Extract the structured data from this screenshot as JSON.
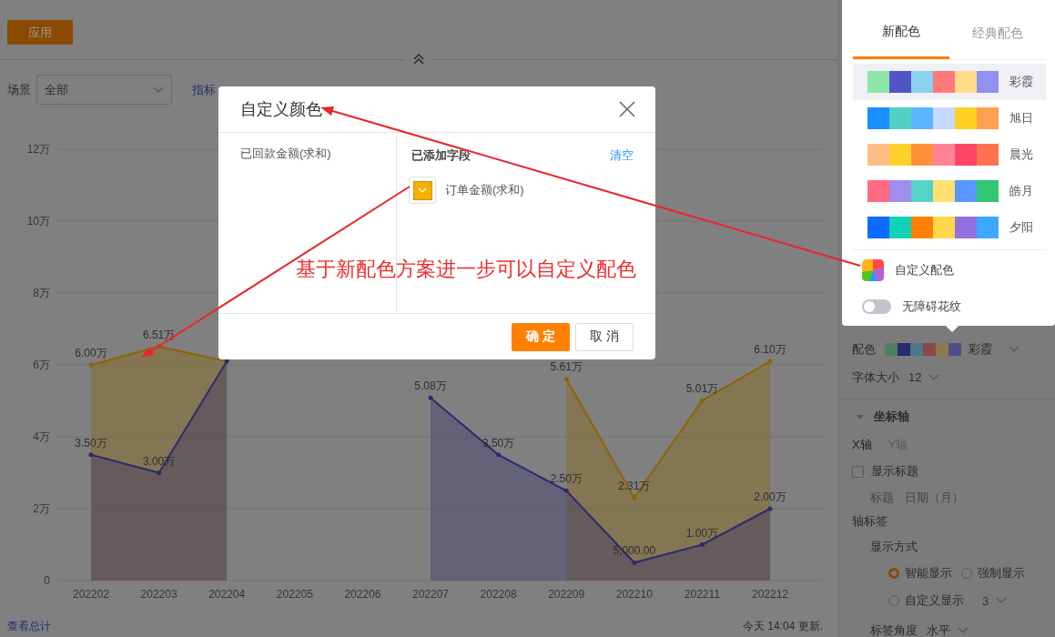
{
  "toolbar": {
    "apply_button": "应用"
  },
  "filters": {
    "scene_label": "场景",
    "scene_select": {
      "value": "全部"
    },
    "metric_link": "指标"
  },
  "chart": {
    "chart_data": {
      "type": "area",
      "categories": [
        "202202",
        "202203",
        "202204",
        "202205",
        "202206",
        "202207",
        "202208",
        "202209",
        "202210",
        "202211",
        "202212"
      ],
      "ylim": [
        0,
        12
      ],
      "grid": true,
      "yticks": [
        {
          "value": 0,
          "label": "0"
        },
        {
          "value": 2,
          "label": "2万"
        },
        {
          "value": 4,
          "label": "4万"
        },
        {
          "value": 6,
          "label": "6万"
        },
        {
          "value": 8,
          "label": "8万"
        },
        {
          "value": 10,
          "label": "10万"
        },
        {
          "value": 12,
          "label": "12万"
        }
      ],
      "series": [
        {
          "type": "area",
          "color": "#8c6400",
          "values": [
            6.0,
            6.51,
            6.1,
            null,
            null,
            null,
            null,
            5.61,
            2.31,
            5.01,
            6.1
          ]
        },
        {
          "type": "area",
          "color": "#2d2b6e",
          "values": [
            3.5,
            3.0,
            6.1,
            null,
            null,
            5.08,
            3.5,
            2.5,
            0.5,
            1.0,
            2.0
          ]
        }
      ],
      "value_labels": [
        [
          "6.00万",
          "6.51万",
          null,
          null,
          null,
          null,
          null,
          "5.61万",
          "2.31万",
          "5.01万",
          "6.10万"
        ],
        [
          "3.50万",
          "3.00万",
          null,
          null,
          null,
          "5.08万",
          "3.50万",
          "2.50万",
          "5,000.00",
          "1.00万",
          "2.00万"
        ]
      ]
    }
  },
  "footer": {
    "total_link": "查看总计",
    "updated": "今天 14:04 更新."
  },
  "settings_panel": {
    "palette": {
      "label": "配色",
      "colors": [
        {
          "color": "#4e8060"
        },
        {
          "color": "#2a2a70"
        },
        {
          "color": "#4a7888"
        },
        {
          "color": "#8a4848"
        },
        {
          "color": "#8a7850"
        },
        {
          "color": "#505088"
        }
      ],
      "value": "彩霞"
    },
    "font_size": {
      "label": "字体大小",
      "value": "12"
    },
    "axis_section": {
      "title": "坐标轴",
      "expanded": true,
      "axis_tabs": [
        {
          "label": "X轴",
          "selected": true
        },
        {
          "label": "Y轴",
          "selected": false
        }
      ],
      "show_title": {
        "label": "显示标题",
        "checked": false
      },
      "title_field": {
        "label": "标题",
        "value": "日期（月）"
      },
      "axis_labels": {
        "title": "轴标签",
        "display_mode_label": "显示方式",
        "modes": [
          {
            "label": "智能显示",
            "selected": true
          },
          {
            "label": "强制显示",
            "selected": false
          },
          {
            "label": "自定义显示",
            "selected": false,
            "count": "3"
          }
        ],
        "angle": {
          "label": "标签角度",
          "value": "水平"
        }
      }
    }
  },
  "color_popover": {
    "tabs": [
      {
        "label": "新配色",
        "selected": true
      },
      {
        "label": "经典配色",
        "selected": false
      }
    ],
    "palettes": [
      {
        "name": "彩霞",
        "selected": true,
        "colors": [
          {
            "color": "#8ee6a8"
          },
          {
            "color": "#5254c4"
          },
          {
            "color": "#8bd2f0"
          },
          {
            "color": "#ff7b7b"
          },
          {
            "color": "#ffdc8c"
          },
          {
            "color": "#9191ee"
          }
        ]
      },
      {
        "name": "旭日",
        "selected": false,
        "colors": [
          {
            "color": "#1890ff"
          },
          {
            "color": "#53d0c6"
          },
          {
            "color": "#5bb5ff"
          },
          {
            "color": "#c6d9ff"
          },
          {
            "color": "#ffd022"
          },
          {
            "color": "#ffa04e"
          }
        ]
      },
      {
        "name": "晨光",
        "selected": false,
        "colors": [
          {
            "color": "#ffbd86"
          },
          {
            "color": "#ffd12d"
          },
          {
            "color": "#ff913c"
          },
          {
            "color": "#ff8394"
          },
          {
            "color": "#ff4566"
          },
          {
            "color": "#ff724f"
          }
        ]
      },
      {
        "name": "皓月",
        "selected": false,
        "colors": [
          {
            "color": "#ff6a83"
          },
          {
            "color": "#9f8eee"
          },
          {
            "color": "#54d3c6"
          },
          {
            "color": "#ffe070"
          },
          {
            "color": "#5897ff"
          },
          {
            "color": "#2fc674"
          }
        ]
      },
      {
        "name": "夕阳",
        "selected": false,
        "colors": [
          {
            "color": "#0e6bff"
          },
          {
            "color": "#11d3b7"
          },
          {
            "color": "#ff8000"
          },
          {
            "color": "#ffd74a"
          },
          {
            "color": "#9370e0"
          },
          {
            "color": "#3aa8ff"
          }
        ]
      }
    ],
    "custom_option": "自定义配色",
    "pattern_toggle": {
      "label": "无障碍花纹",
      "on": false
    }
  },
  "dialog": {
    "title": "自定义颜色",
    "fields": [
      {
        "label": "已回款金额(求和)"
      }
    ],
    "added_header": "已添加字段",
    "clear_link": "清空",
    "added_fields": [
      {
        "label": "订单金额(求和)",
        "color": "#f5b000"
      }
    ],
    "buttons": [
      {
        "label": "确 定",
        "kind": "primary"
      },
      {
        "label": "取 消",
        "kind": "default"
      }
    ]
  },
  "annotation": {
    "text": "基于新配色方案进一步可以自定义配色"
  }
}
